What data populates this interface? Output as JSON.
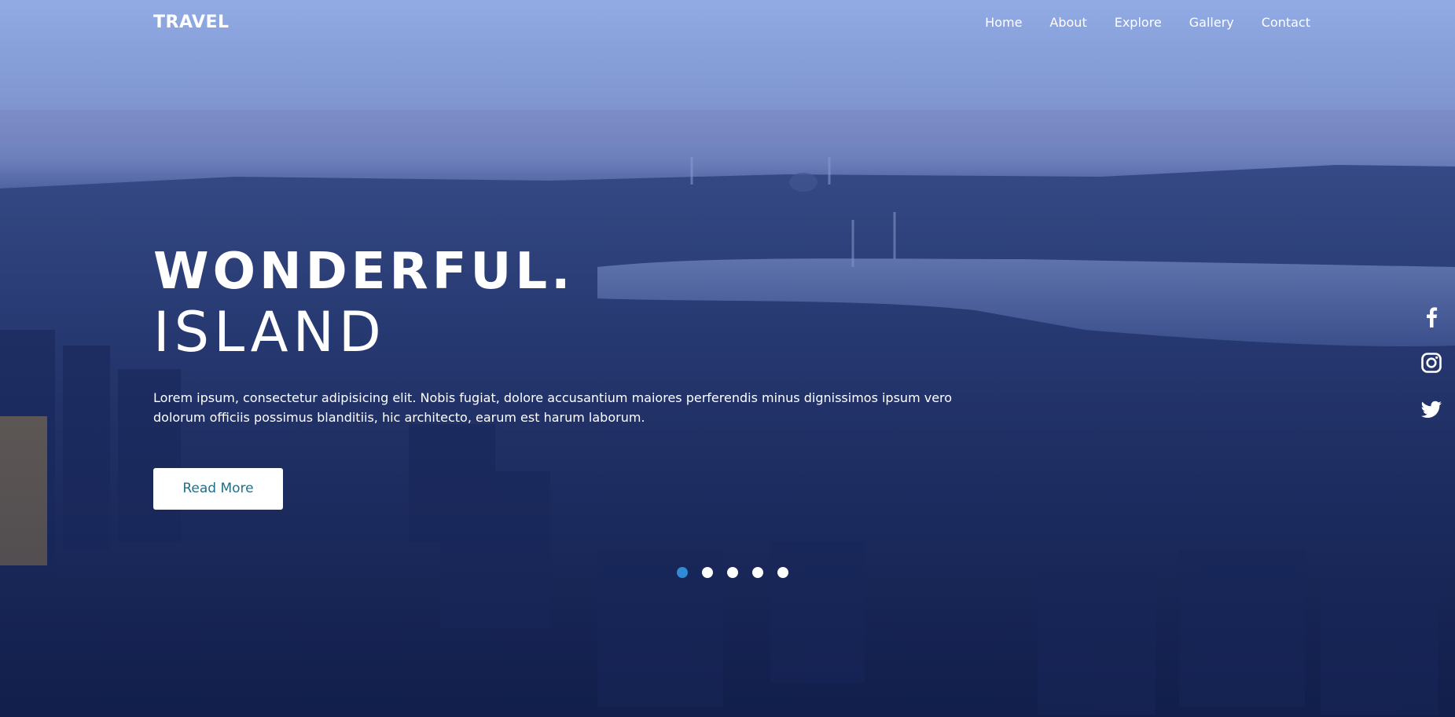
{
  "brand": {
    "logo": "TRAVEL"
  },
  "nav": {
    "items": [
      {
        "label": "Home"
      },
      {
        "label": "About"
      },
      {
        "label": "Explore"
      },
      {
        "label": "Gallery"
      },
      {
        "label": "Contact"
      }
    ]
  },
  "hero": {
    "title_line1": "WONDERFUL.",
    "title_line2": "ISLAND",
    "description": "Lorem ipsum, consectetur adipisicing elit. Nobis fugiat, dolore accusantium maiores perferendis minus dignissimos ipsum vero dolorum officiis possimus blanditiis, hic architecto, earum est harum laborum.",
    "button_label": "Read More",
    "button_text_color": "#1f6f8b",
    "background_image": "city-aerial-dusk"
  },
  "slider": {
    "count": 5,
    "active_index": 0,
    "active_color": "#2f8bd6",
    "inactive_color": "#ffffff"
  },
  "social": {
    "icons": [
      "facebook-icon",
      "instagram-icon",
      "twitter-icon"
    ]
  }
}
